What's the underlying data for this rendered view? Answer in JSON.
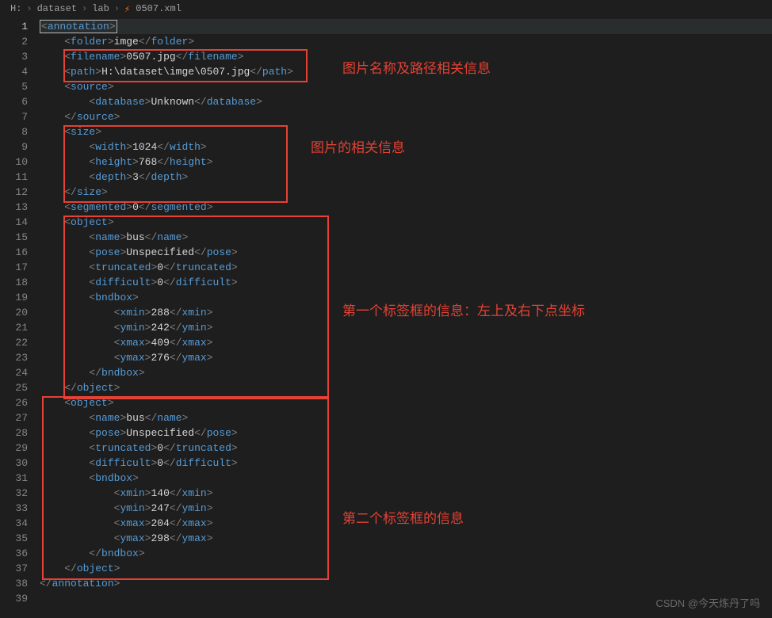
{
  "breadcrumb": {
    "drive": "H:",
    "p1": "dataset",
    "p2": "lab",
    "file": "0507.xml"
  },
  "xml": {
    "root": "annotation",
    "folder_tag": "folder",
    "folder_val": "imge",
    "filename_tag": "filename",
    "filename_val": "0507.jpg",
    "path_tag": "path",
    "path_val": "H:\\dataset\\imge\\0507.jpg",
    "source_tag": "source",
    "database_tag": "database",
    "database_val": "Unknown",
    "size_tag": "size",
    "width_tag": "width",
    "width_val": "1024",
    "height_tag": "height",
    "height_val": "768",
    "depth_tag": "depth",
    "depth_val": "3",
    "segmented_tag": "segmented",
    "segmented_val": "0",
    "object_tag": "object",
    "name_tag": "name",
    "pose_tag": "pose",
    "truncated_tag": "truncated",
    "difficult_tag": "difficult",
    "bndbox_tag": "bndbox",
    "xmin_tag": "xmin",
    "ymin_tag": "ymin",
    "xmax_tag": "xmax",
    "ymax_tag": "ymax",
    "obj1": {
      "name": "bus",
      "pose": "Unspecified",
      "truncated": "0",
      "difficult": "0",
      "xmin": "288",
      "ymin": "242",
      "xmax": "409",
      "ymax": "276"
    },
    "obj2": {
      "name": "bus",
      "pose": "Unspecified",
      "truncated": "0",
      "difficult": "0",
      "xmin": "140",
      "ymin": "247",
      "xmax": "204",
      "ymax": "298"
    }
  },
  "annotations": {
    "a1": "图片名称及路径相关信息",
    "a2": "图片的相关信息",
    "a3": "第一个标签框的信息：左上及右下点坐标",
    "a4": "第二个标签框的信息"
  },
  "watermark": "CSDN @今天炼丹了吗"
}
